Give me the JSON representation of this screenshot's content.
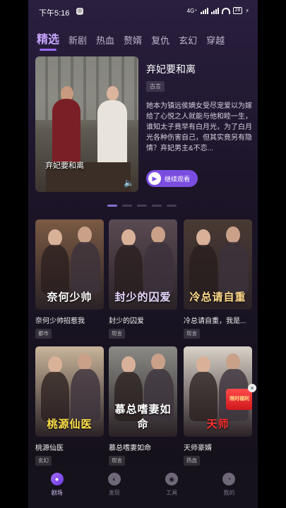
{
  "status_bar": {
    "time": "下午5:16",
    "network": "4G⁺",
    "battery": "28"
  },
  "tabs": [
    {
      "label": "精选",
      "active": true
    },
    {
      "label": "新剧"
    },
    {
      "label": "热血"
    },
    {
      "label": "赘婿"
    },
    {
      "label": "复仇"
    },
    {
      "label": "玄幻"
    },
    {
      "label": "穿越"
    }
  ],
  "featured": {
    "title": "弃妃要和离",
    "tag": "古言",
    "poster_caption": "弃妃要和离",
    "description": "她本为镇远侯嫡女受尽宠爱以为嫁给了心悦之人就能与他和睦一生，谁知太子竟早有白月光，为了白月光各种伤害自己，但其实竟另有隐情？弃妃男主&不恋...",
    "watch_label": "继续观看"
  },
  "pager": {
    "count": 5,
    "active": 0
  },
  "grid": [
    {
      "title": "奈何少帅招惹我",
      "tag": "都市",
      "poster_text": "奈何少帅",
      "poster_color": "#ffffff",
      "bg": "#7a5a43"
    },
    {
      "title": "封少的囚爱",
      "tag": "现言",
      "poster_text": "封少的囚爱",
      "poster_color": "#e9d9ff",
      "bg": "#5a4a52"
    },
    {
      "title": "冷总请自重，我是...",
      "tag": "现言",
      "poster_text": "冷总请自重",
      "poster_color": "#ffd98a",
      "bg": "#4a3a34"
    },
    {
      "title": "桃源仙医",
      "tag": "玄幻",
      "poster_text": "桃源仙医",
      "poster_color": "#ffe14a",
      "bg": "#c9b49a"
    },
    {
      "title": "慕总嗜妻如命",
      "tag": "现言",
      "poster_text": "慕总嗜妻如命",
      "poster_color": "#ffffff",
      "bg": "#8a8a85"
    },
    {
      "title": "天师豪婿",
      "tag": "热血",
      "poster_text": "天师",
      "poster_color": "#ff3030",
      "bg": "#d9d2c8",
      "badge": "限时福利"
    }
  ],
  "nav": [
    {
      "label": "剧场",
      "icon": "theater-icon",
      "glyph": "●",
      "active": true
    },
    {
      "label": "发现",
      "icon": "discover-icon",
      "glyph": "◐"
    },
    {
      "label": "工具",
      "icon": "tools-icon",
      "glyph": "◉"
    },
    {
      "label": "我的",
      "icon": "profile-icon",
      "glyph": "◔"
    }
  ]
}
